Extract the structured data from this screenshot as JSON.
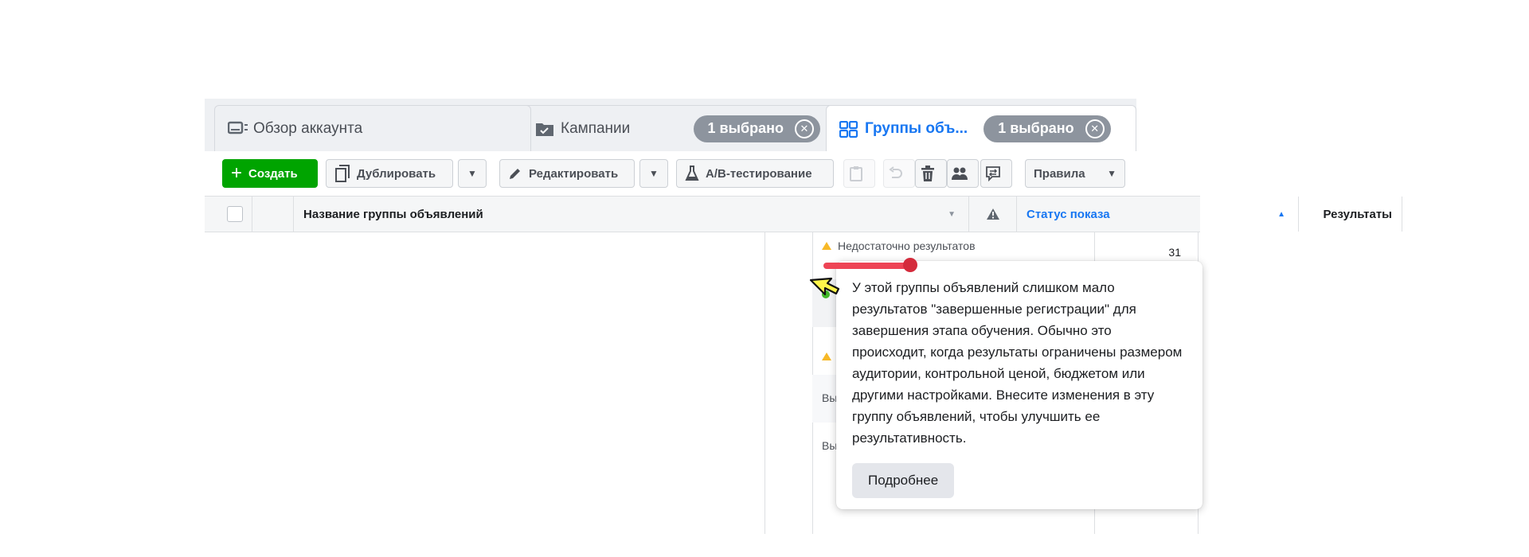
{
  "tabs": {
    "account": {
      "label": "Обзор аккаунта"
    },
    "campaigns": {
      "label": "Кампании",
      "selected": "1 выбрано"
    },
    "adsets": {
      "label": "Группы объ...",
      "selected": "1 выбрано"
    }
  },
  "toolbar": {
    "create": "Создать",
    "duplicate": "Дублировать",
    "edit": "Редактировать",
    "ab_test": "А/В-тестирование",
    "rules": "Правила"
  },
  "table": {
    "columns": {
      "name": "Название группы объявлений",
      "status": "Статус показа",
      "results": "Результаты"
    },
    "rows": [
      {
        "status": "Недостаточно результатов",
        "result": "31"
      },
      {
        "status_truncated": "Вы"
      },
      {
        "status_truncated": "Вы"
      }
    ]
  },
  "tooltip": {
    "text": "У этой группы объявлений слишком мало результатов \"завершенные регистрации\" для завершения этапа обучения. Обычно это происходит, когда результаты ограничены размером аудитории, контрольной ценой, бюджетом или другими настройками. Внесите изменения в эту группу объявлений, чтобы улучшить ее результативность.",
    "button": "Подробнее"
  },
  "colors": {
    "accent": "#1877f2",
    "create_green": "#00a400",
    "warning": "#f7b928",
    "active": "#42b72a",
    "annotation_red": "#ee4455"
  }
}
